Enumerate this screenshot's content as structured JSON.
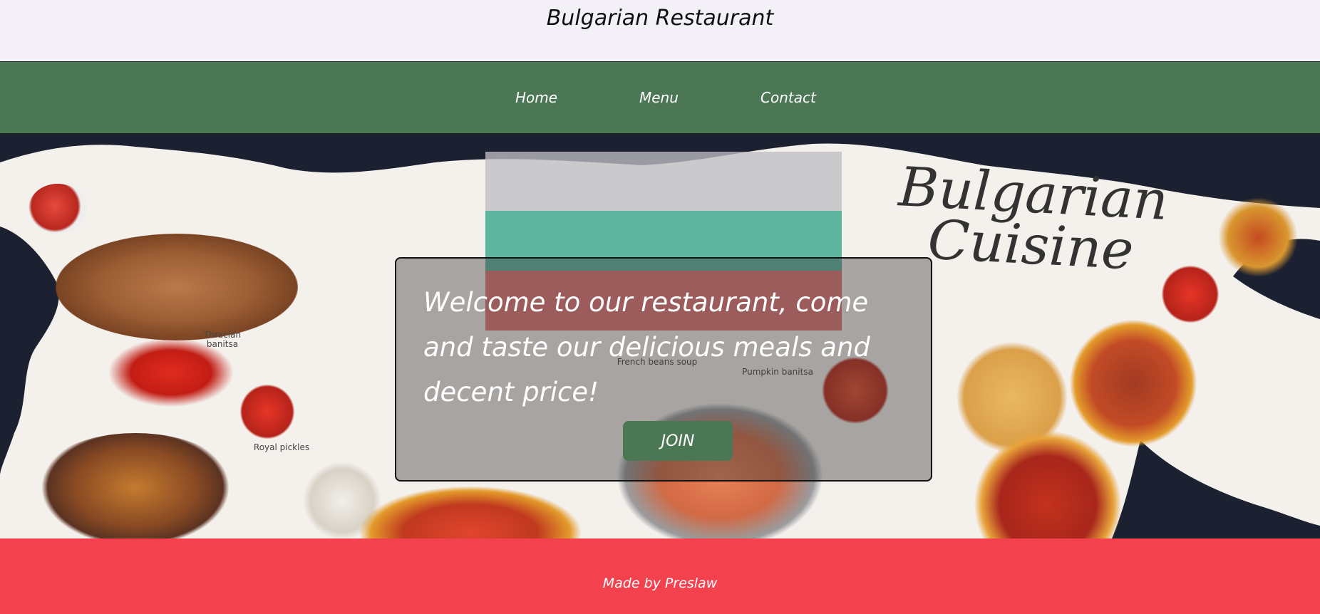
{
  "header": {
    "title": "Bulgarian Restaurant"
  },
  "nav": {
    "items": [
      {
        "label": "Home"
      },
      {
        "label": "Menu"
      },
      {
        "label": "Contact"
      }
    ]
  },
  "hero": {
    "brand_text": "Bulgarian Cuisine",
    "food_labels": [
      "Thracian banitsa",
      "French beans soup",
      "Pumpkin banitsa",
      "Royal pickles"
    ],
    "flag_colors": {
      "white": "#ffffff",
      "green": "#00966e",
      "red": "#d62612"
    },
    "welcome_text": "Welcome to our restaurant, come and taste our delicious meals and decent price!",
    "join_label": "JOIN"
  },
  "footer": {
    "text": "Made by Preslaw"
  },
  "colors": {
    "header_bg": "#f3f1f7",
    "nav_bg": "#4b7754",
    "footer_bg": "#f4414e",
    "button_bg": "#4b7754"
  }
}
